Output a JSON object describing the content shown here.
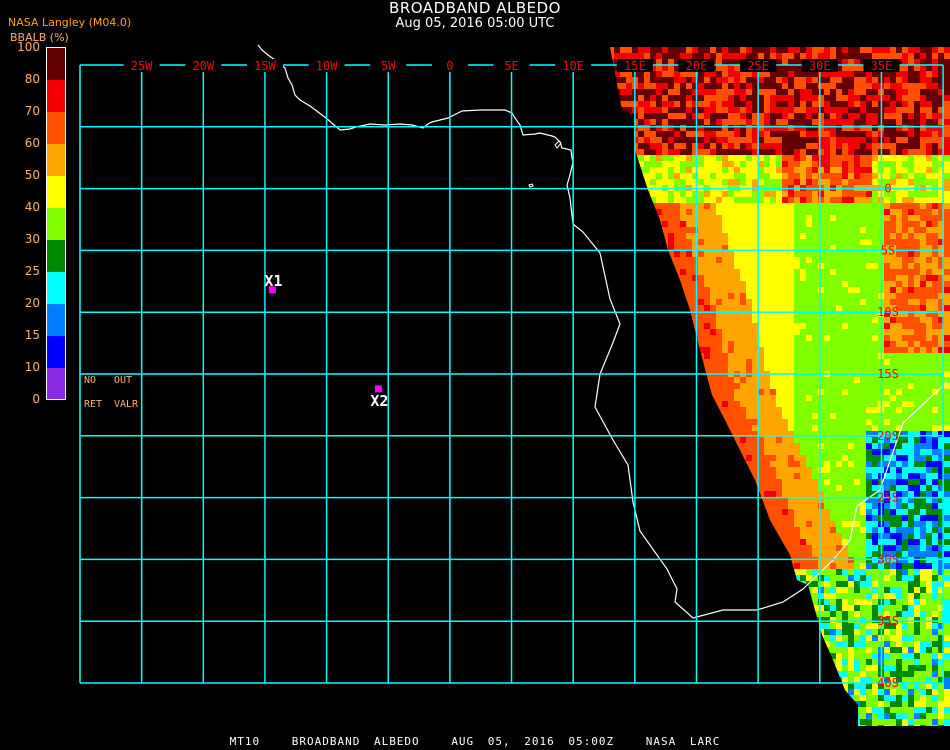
{
  "header": {
    "title": "BROADBAND ALBEDO",
    "subtitle": "Aug 05, 2016 05:00 UTC",
    "provider": "NASA Langley (M04.0)"
  },
  "legend": {
    "title": "BBALB (%)",
    "ticks": [
      "100",
      "80",
      "70",
      "60",
      "50",
      "40",
      "30",
      "25",
      "20",
      "15",
      "10",
      "0"
    ],
    "bins": [
      {
        "min": 80,
        "max": 100,
        "color": "#640000"
      },
      {
        "min": 70,
        "max": 80,
        "color": "#f00000"
      },
      {
        "min": 60,
        "max": 70,
        "color": "#ff5000"
      },
      {
        "min": 50,
        "max": 60,
        "color": "#ffa500"
      },
      {
        "min": 40,
        "max": 50,
        "color": "#ffff00"
      },
      {
        "min": 30,
        "max": 40,
        "color": "#80ff00"
      },
      {
        "min": 25,
        "max": 30,
        "color": "#008800"
      },
      {
        "min": 20,
        "max": 25,
        "color": "#00ffff"
      },
      {
        "min": 15,
        "max": 20,
        "color": "#0080ff"
      },
      {
        "min": 10,
        "max": 15,
        "color": "#0000ff"
      },
      {
        "min": 0,
        "max": 10,
        "color": "#8a2be2"
      }
    ],
    "no_label": "NO",
    "ret_label": "RET",
    "out_label": "OUT",
    "valr_label": "VALR"
  },
  "map": {
    "grid_color": "#00ffff",
    "coast_color": "#ffffff",
    "label_color": "#ff0000",
    "lon_labels": [
      "25W",
      "20W",
      "15W",
      "10W",
      "5W",
      "0",
      "5E",
      "10E",
      "15E",
      "20E",
      "25E",
      "30E",
      "35E"
    ],
    "lat_labels": [
      "0",
      "5S",
      "10S",
      "15S",
      "20S",
      "25S",
      "30S",
      "35S",
      "40S"
    ],
    "markers": [
      {
        "label": "X1",
        "lon": -14.4,
        "lat": -8.2,
        "color": "#ff00ff"
      },
      {
        "label": "X2",
        "lon": -5.8,
        "lat": -16.2,
        "color": "#ff00ff"
      }
    ]
  },
  "footer": {
    "product": "MT10",
    "name": "BROADBAND ALBEDO",
    "datetime": "AUG 05, 2016 05:00Z",
    "source": "NASA LARC"
  }
}
